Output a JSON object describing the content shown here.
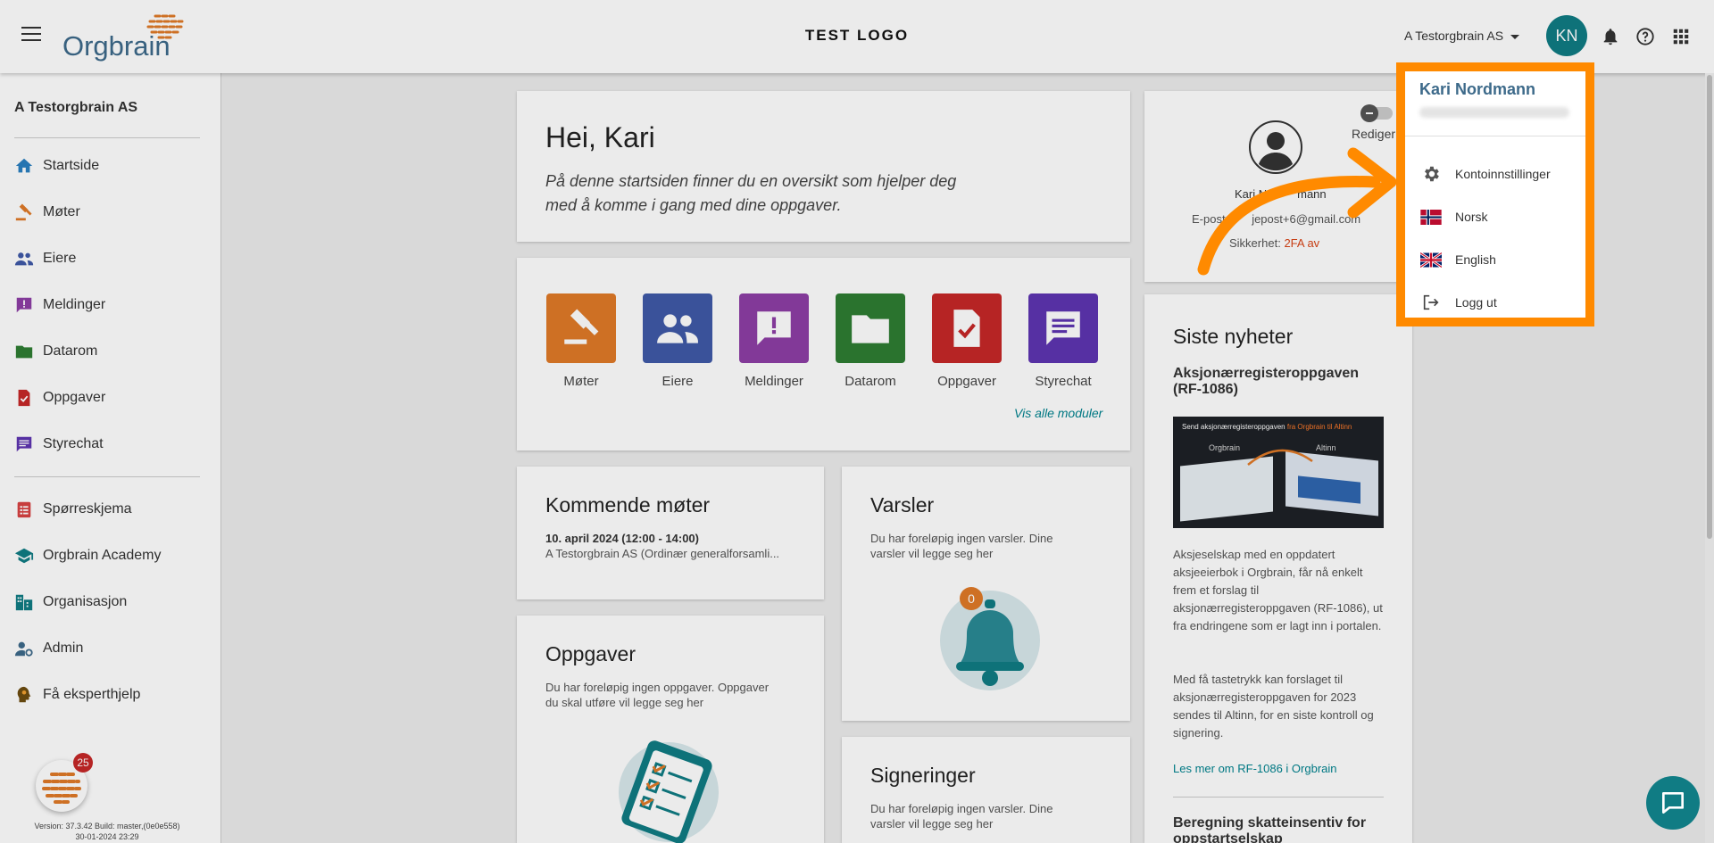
{
  "header": {
    "logo_text": "Orgbrain",
    "center_logo": "TEST LOGO",
    "org_selector": "A Testorgbrain AS",
    "avatar_initials": "KN"
  },
  "sidebar": {
    "org_name": "A Testorgbrain AS",
    "items": [
      {
        "label": "Startside",
        "icon": "home-icon",
        "color": "#2a7fc1"
      },
      {
        "label": "Møter",
        "icon": "gavel-icon",
        "color": "#e07a28"
      },
      {
        "label": "Eiere",
        "icon": "people-icon",
        "color": "#3f5aa8"
      },
      {
        "label": "Meldinger",
        "icon": "message-alert-icon",
        "color": "#8e3ea5"
      },
      {
        "label": "Datarom",
        "icon": "folder-icon",
        "color": "#2e7d32"
      },
      {
        "label": "Oppgaver",
        "icon": "task-icon",
        "color": "#c62828"
      },
      {
        "label": "Styrechat",
        "icon": "chat-icon",
        "color": "#5e35b1"
      },
      {
        "label": "Spørreskjema",
        "icon": "survey-icon",
        "color": "#d84343"
      },
      {
        "label": "Orgbrain Academy",
        "icon": "school-icon",
        "color": "#107c84"
      },
      {
        "label": "Organisasjon",
        "icon": "organization-icon",
        "color": "#107c84"
      },
      {
        "label": "Admin",
        "icon": "admin-icon",
        "color": "#3d6a8a"
      },
      {
        "label": "Få eksperthjelp",
        "icon": "expert-help-icon",
        "color": "#6d4c10"
      }
    ],
    "helper_badge": "25",
    "version_line": "Version: 37.3.42 Build: master,(0e0e558)",
    "version_date": "30-01-2024 23:29"
  },
  "welcome": {
    "title": "Hei, Kari",
    "text_line1": "På denne startsiden finner du en oversikt som hjelper deg",
    "text_line2": "med å komme i gang med dine oppgaver."
  },
  "modules": [
    {
      "label": "Møter",
      "color": "#e07a28",
      "icon": "gavel-icon"
    },
    {
      "label": "Eiere",
      "color": "#3f5aa8",
      "icon": "people-icon"
    },
    {
      "label": "Meldinger",
      "color": "#8e3ea5",
      "icon": "message-alert-icon"
    },
    {
      "label": "Datarom",
      "color": "#2e7d32",
      "icon": "folder-icon"
    },
    {
      "label": "Oppgaver",
      "color": "#c62828",
      "icon": "task-icon"
    },
    {
      "label": "Styrechat",
      "color": "#5e35b1",
      "icon": "chat-icon"
    }
  ],
  "modules_link": "Vis alle moduler",
  "meetings": {
    "title": "Kommende møter",
    "date": "10. april 2024 (12:00 - 14:00)",
    "desc": "A Testorgbrain AS (Ordinær generalforsamli..."
  },
  "alerts": {
    "title": "Varsler",
    "text_line1": "Du har foreløpig ingen varsler. Dine",
    "text_line2": "varsler vil legge seg her",
    "count": "0"
  },
  "tasks": {
    "title": "Oppgaver",
    "text_line1": "Du har foreløpig ingen oppgaver. Oppgaver",
    "text_line2": "du skal utføre vil legge seg her"
  },
  "signatures": {
    "title": "Signeringer",
    "text_line1": "Du har foreløpig ingen varsler. Dine",
    "text_line2": "varsler vil legge seg her"
  },
  "profile": {
    "toggle_label": "Rediger",
    "name": "Kari N",
    "name_tail": "mann",
    "email_prefix": "E-post:",
    "email_tail": "jepost+6@gmail.com",
    "security_label": "Sikkerhet:",
    "security_value": "2FA av"
  },
  "news": {
    "title": "Siste nyheter",
    "article_title": "Aksjonærregisteroppgaven (RF-1086)",
    "image_caption_prefix": "Send aksjonærregisteroppgaven",
    "image_caption_highlight": "fra Orgbrain til Altinn",
    "image_left": "Orgbrain",
    "image_right": "Altinn",
    "para1": "Aksjeselskap med en oppdatert aksjeeierbok i Orgbrain, får nå enkelt frem et forslag til aksjonærregisteroppgaven (RF-1086), ut fra endringene som er lagt inn i portalen.",
    "para2": "Med få tastetrykk kan forslaget til aksjonærregisteroppgaven for 2023 sendes til Altinn, for en siste kontroll og signering.",
    "link": "Les mer om RF-1086 i Orgbrain",
    "next_title": "Beregning skatteinsentiv for oppstartselskap"
  },
  "user_menu": {
    "name": "Kari Nordmann",
    "items": [
      {
        "label": "Kontoinnstillinger",
        "icon": "gear-icon"
      },
      {
        "label": "Norsk",
        "icon": "norway-flag-icon"
      },
      {
        "label": "English",
        "icon": "uk-flag-icon"
      },
      {
        "label": "Logg ut",
        "icon": "logout-icon"
      }
    ]
  },
  "colors": {
    "accent": "#107c84",
    "highlight": "#ff8a00",
    "brand_blue": "#3d6a8a",
    "brand_orange": "#e07a28"
  }
}
